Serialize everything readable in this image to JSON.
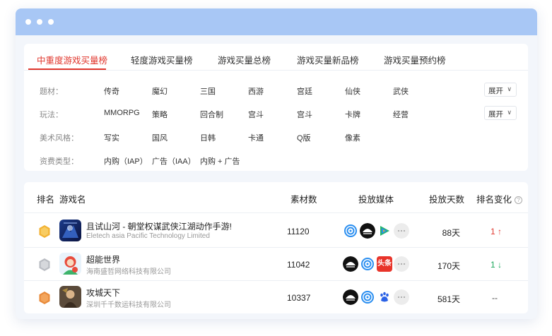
{
  "tabs": [
    {
      "label": "中重度游戏买量榜",
      "active": true
    },
    {
      "label": "轻度游戏买量榜",
      "active": false
    },
    {
      "label": "游戏买量总榜",
      "active": false
    },
    {
      "label": "游戏买量新品榜",
      "active": false
    },
    {
      "label": "游戏买量预约榜",
      "active": false
    }
  ],
  "filters": {
    "theme": {
      "label": "题材：",
      "options": [
        "传奇",
        "魔幻",
        "三国",
        "西游",
        "宫廷",
        "仙侠",
        "武侠"
      ],
      "expand": "展开"
    },
    "gameplay": {
      "label": "玩法：",
      "options": [
        "MMORPG",
        "策略",
        "回合制",
        "宫斗",
        "宫斗",
        "卡牌",
        "经营"
      ],
      "expand": "展开"
    },
    "art": {
      "label": "美术风格：",
      "options": [
        "写实",
        "国风",
        "日韩",
        "卡通",
        "Q版",
        "像素"
      ]
    },
    "pay": {
      "label": "资费类型：",
      "options": [
        "内购（IAP）",
        "广告（IAA）",
        "内购 + 广告"
      ]
    }
  },
  "table": {
    "headers": {
      "rank": "排名",
      "game": "游戏名",
      "materials": "素材数",
      "media": "投放媒体",
      "days": "投放天数",
      "change": "排名变化"
    },
    "rows": [
      {
        "rank": "1",
        "name": "且试山河 - 朝堂权谋武侠江湖动作手游!",
        "publisher": "Eletech asia Pacific Technology Limited",
        "materials": "11120",
        "days": "88天",
        "change": "1 ↑",
        "change_dir": "up",
        "media": [
          "ring-icon",
          "pangle-icon",
          "tencent-video-icon",
          "more-icon"
        ]
      },
      {
        "rank": "2",
        "name": "超能世界",
        "publisher": "海南盛哲网络科技有限公司",
        "materials": "11042",
        "days": "170天",
        "change": "1 ↓",
        "change_dir": "down",
        "media": [
          "pangle-icon",
          "ring-icon",
          "toutiao-icon",
          "more-icon"
        ]
      },
      {
        "rank": "3",
        "name": "攻城天下",
        "publisher": "深圳千千数运科技有限公司",
        "materials": "10337",
        "days": "581天",
        "change": "--",
        "change_dir": "none",
        "media": [
          "pangle-icon",
          "ring-icon",
          "baidu-icon",
          "more-icon"
        ]
      }
    ]
  },
  "toutiao_text": "头条",
  "help_glyph": "?",
  "colors": {
    "accent": "#e0362c",
    "up": "#e0362c",
    "down": "#1aa65a",
    "titlebar": "#a8c7f5"
  }
}
